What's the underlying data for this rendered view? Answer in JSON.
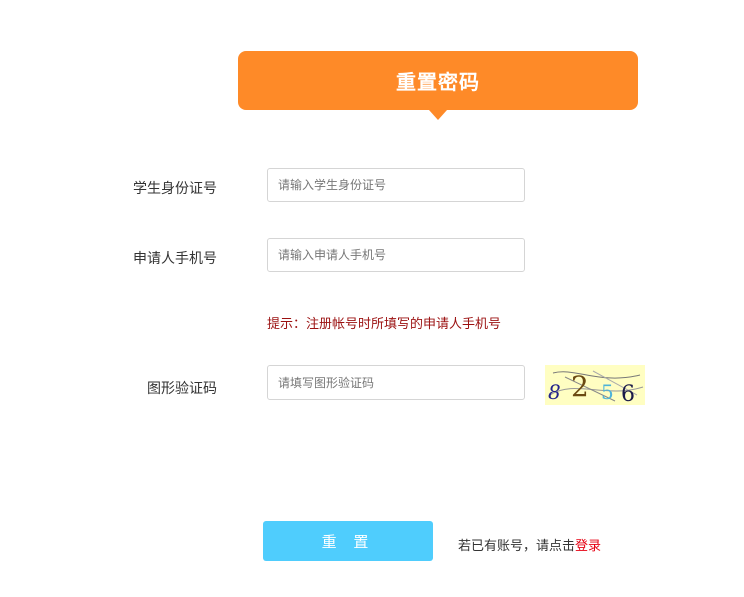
{
  "header": {
    "title": "重置密码"
  },
  "form": {
    "student_id": {
      "label": "学生身份证号",
      "placeholder": "请输入学生身份证号"
    },
    "phone": {
      "label": "申请人手机号",
      "placeholder": "请输入申请人手机号"
    },
    "hint": "提示：注册帐号时所填写的申请人手机号",
    "captcha": {
      "label": "图形验证码",
      "placeholder": "请填写图形验证码",
      "code": [
        "8",
        "2",
        "5",
        "6"
      ]
    }
  },
  "actions": {
    "reset_label": "重 置",
    "login_prompt": "若已有账号，请点击",
    "login_link": "登录"
  },
  "colors": {
    "header_bg": "#fe8a28",
    "button_bg": "#4fcdfd",
    "hint_text": "#9b1010",
    "link": "#e60012",
    "captcha_bg": "#fffec2"
  }
}
